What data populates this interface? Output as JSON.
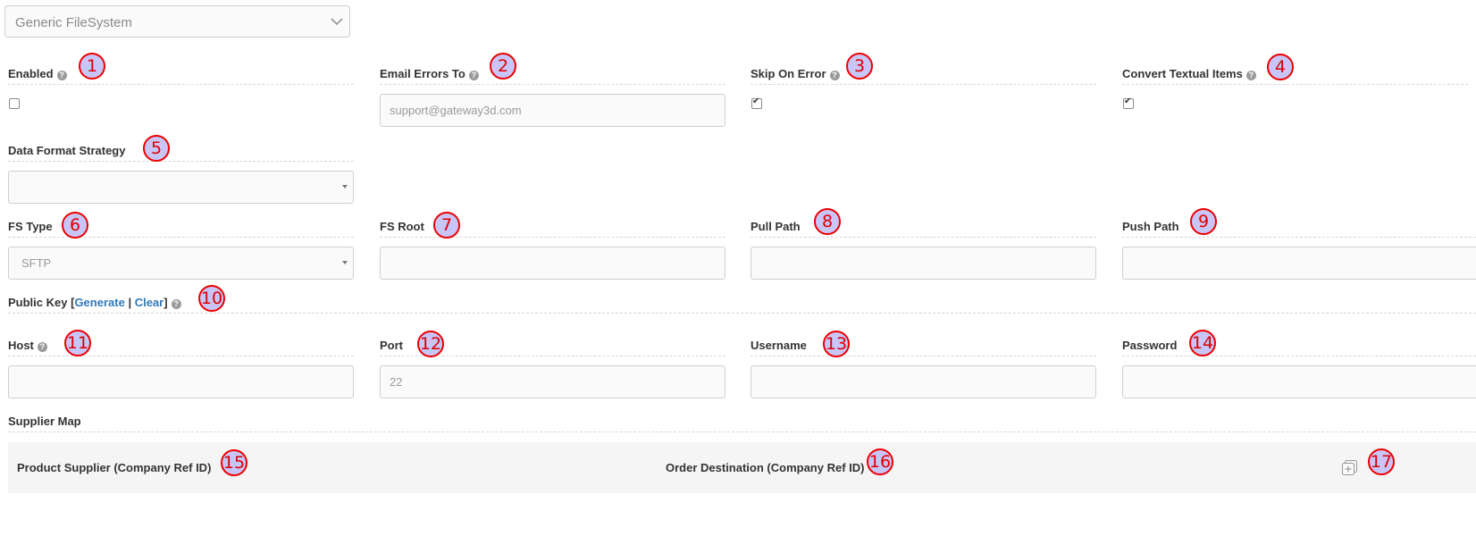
{
  "header": {
    "connector_select_value": "Generic FileSystem"
  },
  "fields": {
    "enabled": {
      "label": "Enabled",
      "checked": false
    },
    "email_errors": {
      "label": "Email Errors To",
      "placeholder": "support@gateway3d.com"
    },
    "skip_on_error": {
      "label": "Skip On Error",
      "checked": true
    },
    "convert_textual": {
      "label": "Convert Textual Items",
      "checked": true
    },
    "data_format": {
      "label": "Data Format Strategy",
      "value": ""
    },
    "fs_type": {
      "label": "FS Type",
      "value": "SFTP"
    },
    "fs_root": {
      "label": "FS Root",
      "value": ""
    },
    "pull_path": {
      "label": "Pull Path",
      "value": ""
    },
    "push_path": {
      "label": "Push Path",
      "value": ""
    },
    "public_key": {
      "label": "Public Key",
      "open_bracket": "[",
      "generate_label": "Generate",
      "separator": "|",
      "clear_label": "Clear",
      "close_bracket": "]"
    },
    "host": {
      "label": "Host",
      "value": ""
    },
    "port": {
      "label": "Port",
      "placeholder": "22"
    },
    "username": {
      "label": "Username",
      "value": ""
    },
    "password": {
      "label": "Password",
      "value": ""
    }
  },
  "supplier_map": {
    "title": "Supplier Map",
    "col_product_supplier": "Product Supplier (Company Ref ID)",
    "col_order_destination": "Order Destination (Company Ref ID)"
  },
  "markers": [
    "1",
    "2",
    "3",
    "4",
    "5",
    "6",
    "7",
    "8",
    "9",
    "10",
    "11",
    "12",
    "13",
    "14",
    "15",
    "16",
    "17"
  ],
  "colors": {
    "link": "#337ab7",
    "marker_fill": "#c8c6f8",
    "marker_border": "#ee0000"
  },
  "icons": {
    "help": "question-circle-icon",
    "chevron": "chevron-down-icon",
    "add": "add-row-icon"
  }
}
